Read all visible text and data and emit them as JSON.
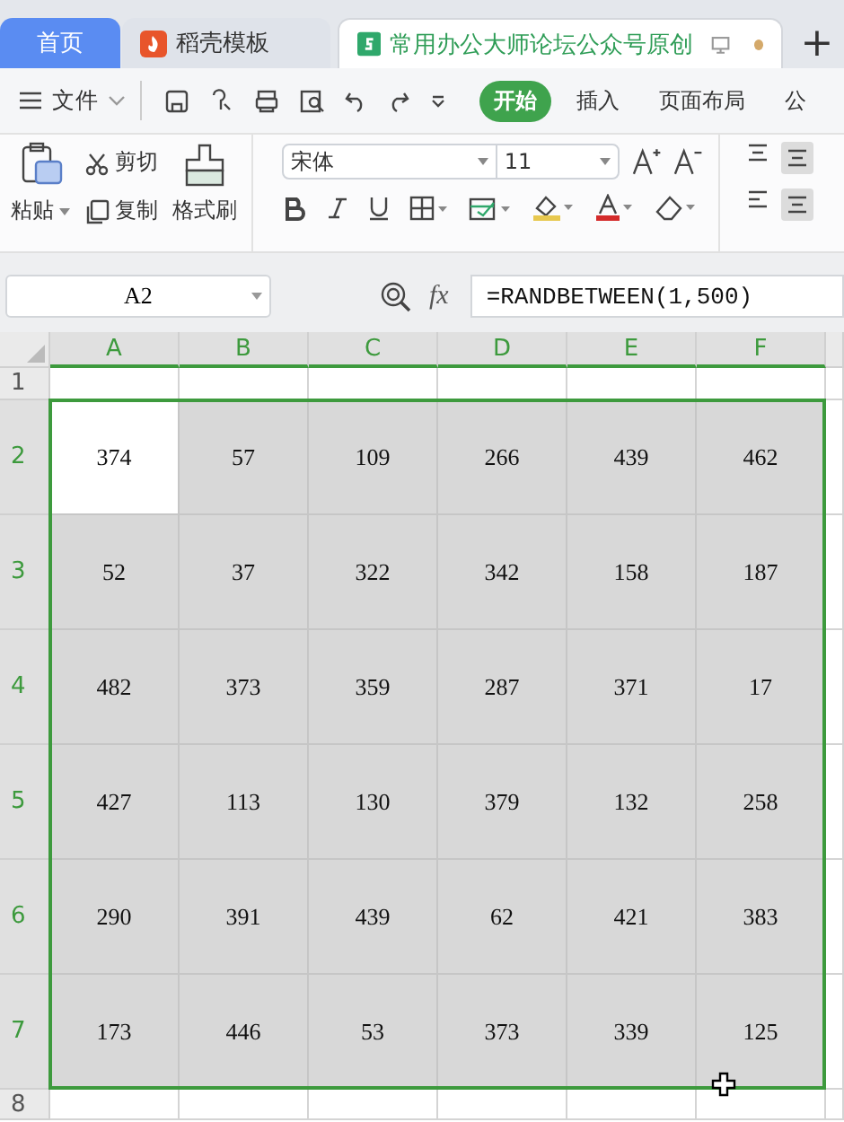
{
  "tabs": [
    {
      "label": "首页",
      "selected": false,
      "kind": "home"
    },
    {
      "label": "稻壳模板",
      "selected": false,
      "kind": "template"
    },
    {
      "label": "常用办公大师论坛公众号原创",
      "selected": true,
      "kind": "document",
      "unsaved": true
    }
  ],
  "new_tab": "+",
  "file_menu": "文件",
  "ribbon_tabs": [
    {
      "label": "开始",
      "selected": true
    },
    {
      "label": "插入",
      "selected": false
    },
    {
      "label": "页面布局",
      "selected": false
    },
    {
      "label": "公",
      "selected": false
    }
  ],
  "clipboard": {
    "paste": "粘贴",
    "cut": "剪切",
    "copy": "复制",
    "format_painter": "格式刷"
  },
  "font": {
    "name": "宋体",
    "size": "11"
  },
  "formula_bar": {
    "name_box": "A2",
    "fx": "fx",
    "formula": "=RANDBETWEEN(1,500)"
  },
  "grid": {
    "columns": [
      {
        "label": "A",
        "selected": true
      },
      {
        "label": "B",
        "selected": true
      },
      {
        "label": "C",
        "selected": true
      },
      {
        "label": "D",
        "selected": true
      },
      {
        "label": "E",
        "selected": true
      },
      {
        "label": "F",
        "selected": true
      }
    ],
    "rows": [
      {
        "label": "1",
        "selected": false
      },
      {
        "label": "2",
        "selected": true,
        "cells": [
          {
            "value": "374",
            "active": true
          },
          {
            "value": "57",
            "active": false
          },
          {
            "value": "109",
            "active": false
          },
          {
            "value": "266",
            "active": false
          },
          {
            "value": "439",
            "active": false
          },
          {
            "value": "462",
            "active": false
          }
        ]
      },
      {
        "label": "3",
        "selected": true,
        "cells": [
          {
            "value": "52",
            "active": false
          },
          {
            "value": "37",
            "active": false
          },
          {
            "value": "322",
            "active": false
          },
          {
            "value": "342",
            "active": false
          },
          {
            "value": "158",
            "active": false
          },
          {
            "value": "187",
            "active": false
          }
        ]
      },
      {
        "label": "4",
        "selected": true,
        "cells": [
          {
            "value": "482",
            "active": false
          },
          {
            "value": "373",
            "active": false
          },
          {
            "value": "359",
            "active": false
          },
          {
            "value": "287",
            "active": false
          },
          {
            "value": "371",
            "active": false
          },
          {
            "value": "17",
            "active": false
          }
        ]
      },
      {
        "label": "5",
        "selected": true,
        "cells": [
          {
            "value": "427",
            "active": false
          },
          {
            "value": "113",
            "active": false
          },
          {
            "value": "130",
            "active": false
          },
          {
            "value": "379",
            "active": false
          },
          {
            "value": "132",
            "active": false
          },
          {
            "value": "258",
            "active": false
          }
        ]
      },
      {
        "label": "6",
        "selected": true,
        "cells": [
          {
            "value": "290",
            "active": false
          },
          {
            "value": "391",
            "active": false
          },
          {
            "value": "439",
            "active": false
          },
          {
            "value": "62",
            "active": false
          },
          {
            "value": "421",
            "active": false
          },
          {
            "value": "383",
            "active": false
          }
        ]
      },
      {
        "label": "7",
        "selected": true,
        "cells": [
          {
            "value": "173",
            "active": false
          },
          {
            "value": "446",
            "active": false
          },
          {
            "value": "53",
            "active": false
          },
          {
            "value": "373",
            "active": false
          },
          {
            "value": "339",
            "active": false
          },
          {
            "value": "125",
            "active": false
          }
        ]
      },
      {
        "label": "8",
        "selected": false
      }
    ]
  }
}
